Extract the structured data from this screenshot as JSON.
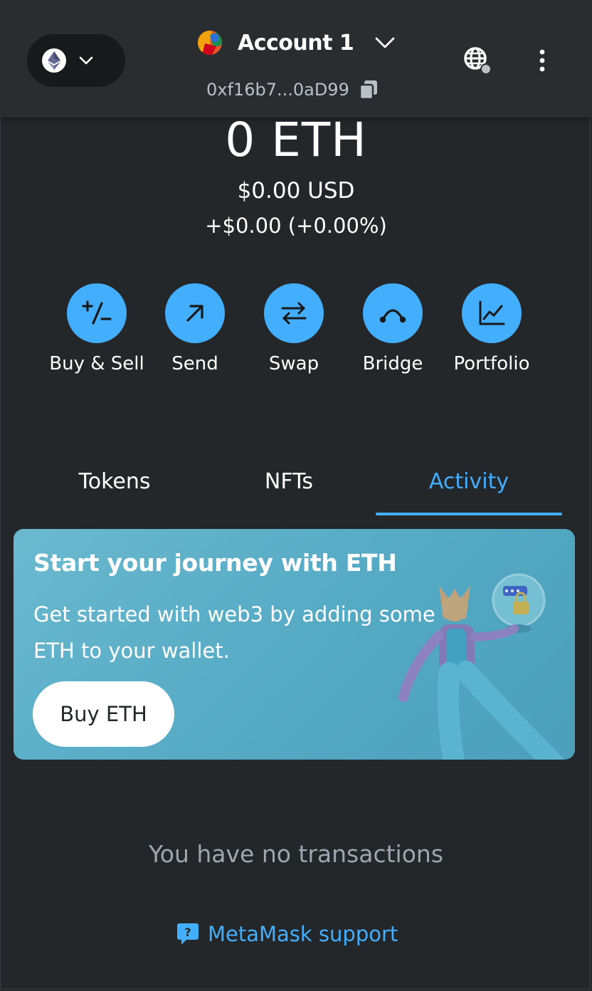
{
  "header": {
    "network_icon": "ethereum-icon",
    "account_name": "Account 1",
    "address": "0xf16b7...0aD99"
  },
  "balance": {
    "main": "0 ETH",
    "usd": "$0.00 USD",
    "change": "+$0.00 (+0.00%)"
  },
  "actions": [
    {
      "label": "Buy & Sell",
      "icon": "buy-sell-icon"
    },
    {
      "label": "Send",
      "icon": "send-arrow-icon"
    },
    {
      "label": "Swap",
      "icon": "swap-icon"
    },
    {
      "label": "Bridge",
      "icon": "bridge-icon"
    },
    {
      "label": "Portfolio",
      "icon": "portfolio-chart-icon"
    }
  ],
  "tabs": [
    {
      "label": "Tokens",
      "active": false
    },
    {
      "label": "NFTs",
      "active": false
    },
    {
      "label": "Activity",
      "active": true
    }
  ],
  "banner": {
    "title": "Start your journey with ETH",
    "text": "Get started with web3 by adding some ETH to your wallet.",
    "button": "Buy ETH"
  },
  "empty_state": "You have no transactions",
  "support_link": "MetaMask support",
  "colors": {
    "background": "#24272a",
    "header": "#2a2d30",
    "accent": "#43aefc",
    "banner": "#54a9c3",
    "muted_text": "#9fa6ae"
  }
}
